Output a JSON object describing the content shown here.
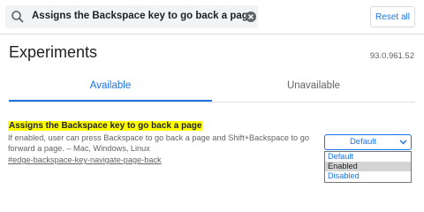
{
  "search": {
    "query": "Assigns the Backspace key to go back a page"
  },
  "header": {
    "reset_label": "Reset all"
  },
  "page": {
    "title": "Experiments",
    "version": "93.0.961.52"
  },
  "tabs": [
    {
      "label": "Available",
      "active": true
    },
    {
      "label": "Unavailable",
      "active": false
    }
  ],
  "experiment": {
    "name": "Assigns the Backspace key to go back a page",
    "description": "If enabled, user can press Backspace to go back a page and Shift+Backspace to go forward a page. – Mac, Windows, Linux",
    "link": "#edge-backspace-key-navigate-page-back",
    "selected": "Default",
    "options": [
      "Default",
      "Enabled",
      "Disabled"
    ],
    "highlighted_option": "Enabled"
  },
  "colors": {
    "accent": "#1a73e8",
    "highlight": "#ffff00",
    "text": "#202124",
    "muted": "#5f6368"
  },
  "icons": [
    "search-icon",
    "clear-icon",
    "chevron-down-icon"
  ]
}
